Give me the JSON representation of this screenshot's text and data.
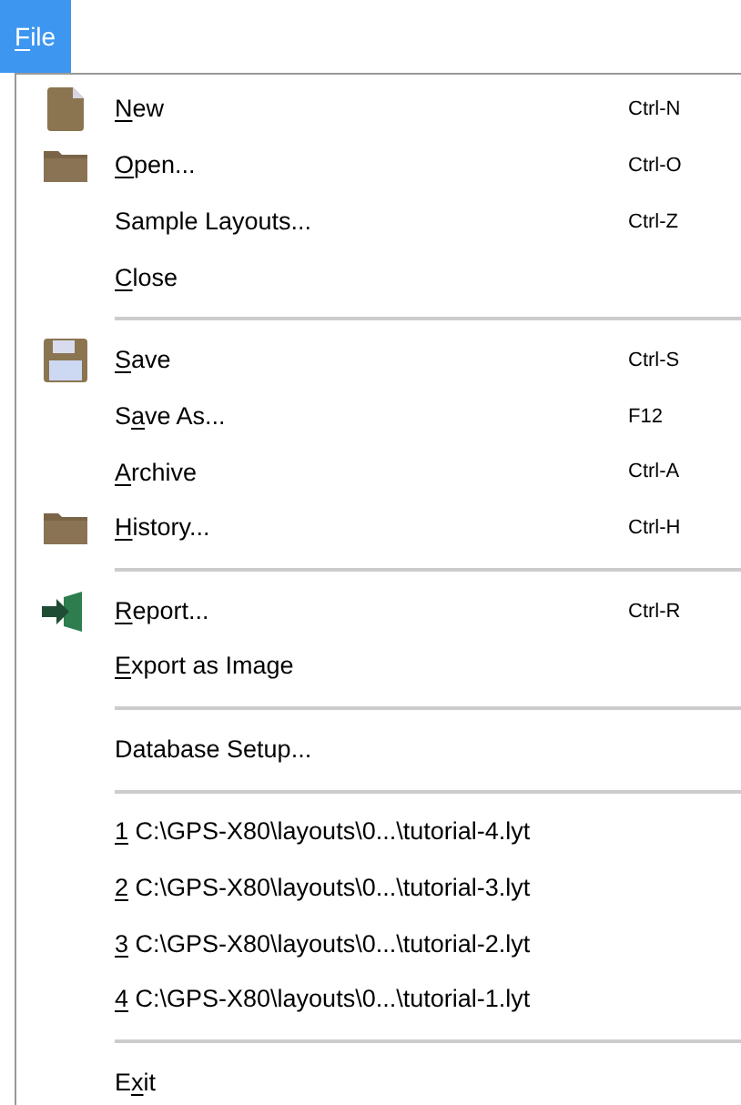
{
  "menubar": [
    {
      "mnemonic": "F",
      "label_end": "ile",
      "selected": true
    }
  ],
  "menu": {
    "items": [
      {
        "kind": "document",
        "mnemonic": "N",
        "label_end": "ew",
        "shortcut": "Ctrl-N"
      },
      {
        "kind": "folder",
        "mnemonic": "O",
        "label_end": "pen...",
        "shortcut": "Ctrl-O"
      },
      {
        "kind": "plain",
        "label_start": "Sample Layouts...",
        "shortcut": "Ctrl-Z"
      },
      {
        "kind": "plain",
        "mnemonic": "C",
        "label_end": "lose"
      },
      {
        "kind": "separator"
      },
      {
        "kind": "floppy",
        "mnemonic": "S",
        "label_end": "ave",
        "shortcut": "Ctrl-S"
      },
      {
        "kind": "plain",
        "label_start": "S",
        "mnemonic": "a",
        "label_end": "ve As...",
        "shortcut": "F12"
      },
      {
        "kind": "plain",
        "mnemonic": "A",
        "label_end": "rchive",
        "shortcut": "Ctrl-A"
      },
      {
        "kind": "folder",
        "mnemonic": "H",
        "label_end": "istory...",
        "shortcut": "Ctrl-H"
      },
      {
        "kind": "separator"
      },
      {
        "kind": "export",
        "mnemonic": "R",
        "label_end": "eport...",
        "shortcut": "Ctrl-R"
      },
      {
        "kind": "plain",
        "mnemonic": "E",
        "label_end": "xport as Image"
      },
      {
        "kind": "separator"
      },
      {
        "kind": "plain",
        "label_start": "Database Setup..."
      },
      {
        "kind": "separator"
      },
      {
        "kind": "plain",
        "mnemonic": "1",
        "label_end": " C:\\GPS-X80\\layouts\\0...\\tutorial-4.lyt"
      },
      {
        "kind": "plain",
        "mnemonic": "2",
        "label_end": " C:\\GPS-X80\\layouts\\0...\\tutorial-3.lyt"
      },
      {
        "kind": "plain",
        "mnemonic": "3",
        "label_end": " C:\\GPS-X80\\layouts\\0...\\tutorial-2.lyt"
      },
      {
        "kind": "plain",
        "mnemonic": "4",
        "label_end": " C:\\GPS-X80\\layouts\\0...\\tutorial-1.lyt"
      },
      {
        "kind": "separator"
      },
      {
        "kind": "plain",
        "label_start": "E",
        "mnemonic": "x",
        "label_end": "it"
      }
    ]
  }
}
